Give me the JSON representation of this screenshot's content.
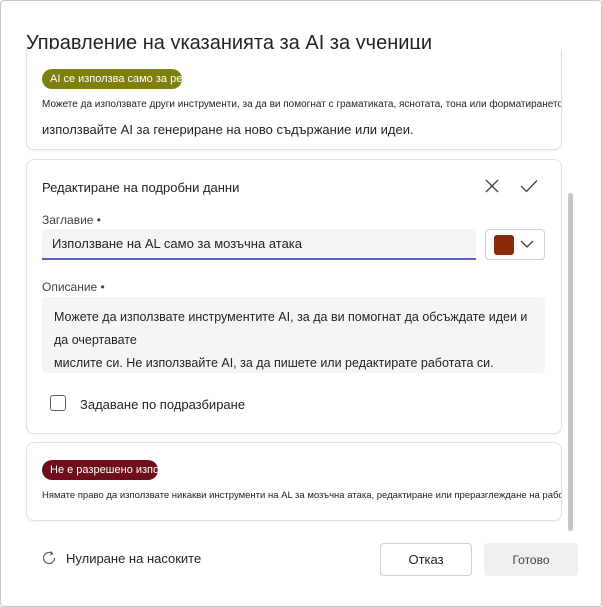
{
  "dialog": {
    "title": "Управление на указанията за AI за ученици"
  },
  "cards": {
    "allowed_partial": {
      "badge": "AI се използва само за ре",
      "badge_color": "#7f7f10",
      "line1": "Можете да използвате други инструменти, за да ви помогнат с граматиката, яснотата, тона или форматирането. Не",
      "line2": "използвайте AI за генериране на ново съдържание или идеи."
    },
    "edit": {
      "header": "Редактиране на подробни данни",
      "title_label": "Заглавие •",
      "title_value": "Използване на AL само за мозъчна атака",
      "swatch_color": "#8b2a0a",
      "description_label": "Описание •",
      "description_value": "Можете да използвате инструментите AI, за да ви помогнат да обсъждате идеи и да очертавате\nмислите си. Не използвайте AI, за да пишете или редактирате работата си.",
      "default_label": "Задаване по подразбиране"
    },
    "not_allowed": {
      "badge": "Не е разрешено изпо",
      "badge_color": "#6e0f1a",
      "line1": "Нямате право да използвате никакви инструменти на AL за мозъчна атака, редактиране или преразглеждане на работата си."
    }
  },
  "footer": {
    "reset_label": "Нулиране на насоките",
    "cancel_label": "Отказ",
    "done_label": "Готово"
  }
}
